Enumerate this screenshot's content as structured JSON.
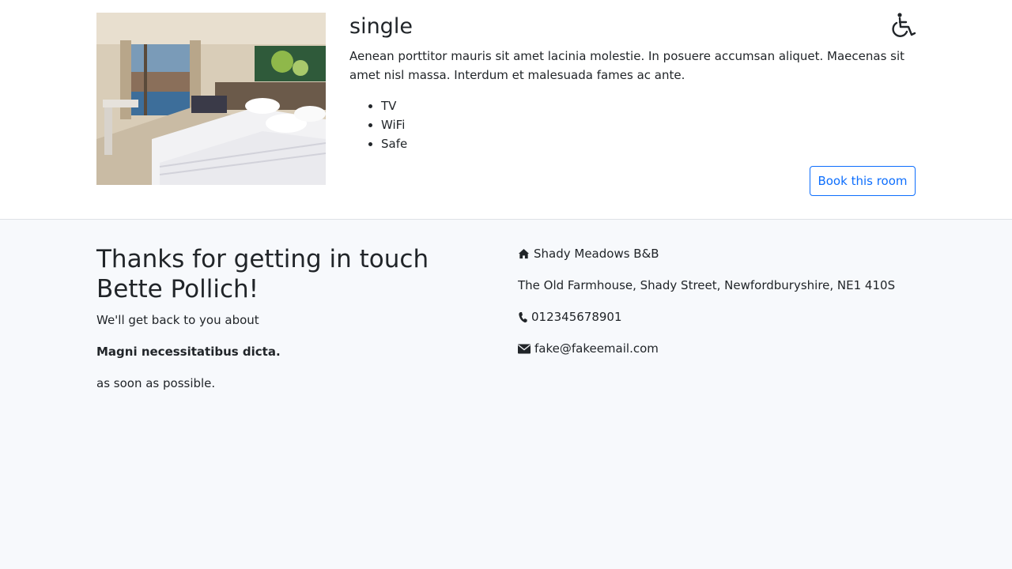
{
  "room": {
    "title": "single",
    "description": "Aenean porttitor mauris sit amet lacinia molestie. In posuere accumsan aliquet. Maecenas sit amet nisl massa. Interdum et malesuada fames ac ante.",
    "features": [
      "TV",
      "WiFi",
      "Safe"
    ],
    "book_label": "Book this room",
    "image_icon": "hotel-room-photo",
    "accessibility_icon": "wheelchair-icon"
  },
  "contact_message": {
    "heading": "Thanks for getting in touch Bette Pollich!",
    "intro": "We'll get back to you about",
    "subject": "Magni necessitatibus dicta.",
    "outro": "as soon as possible."
  },
  "business": {
    "name": "Shady Meadows B&B",
    "address": "The Old Farmhouse, Shady Street, Newfordburyshire, NE1 410S",
    "phone": "012345678901",
    "email": "fake@fakeemail.com",
    "icons": {
      "name": "home-icon",
      "phone": "phone-icon",
      "email": "envelope-icon"
    }
  },
  "colors": {
    "accent": "#0d6efd",
    "contact_bg": "#f7f9fc",
    "text": "#212529"
  }
}
